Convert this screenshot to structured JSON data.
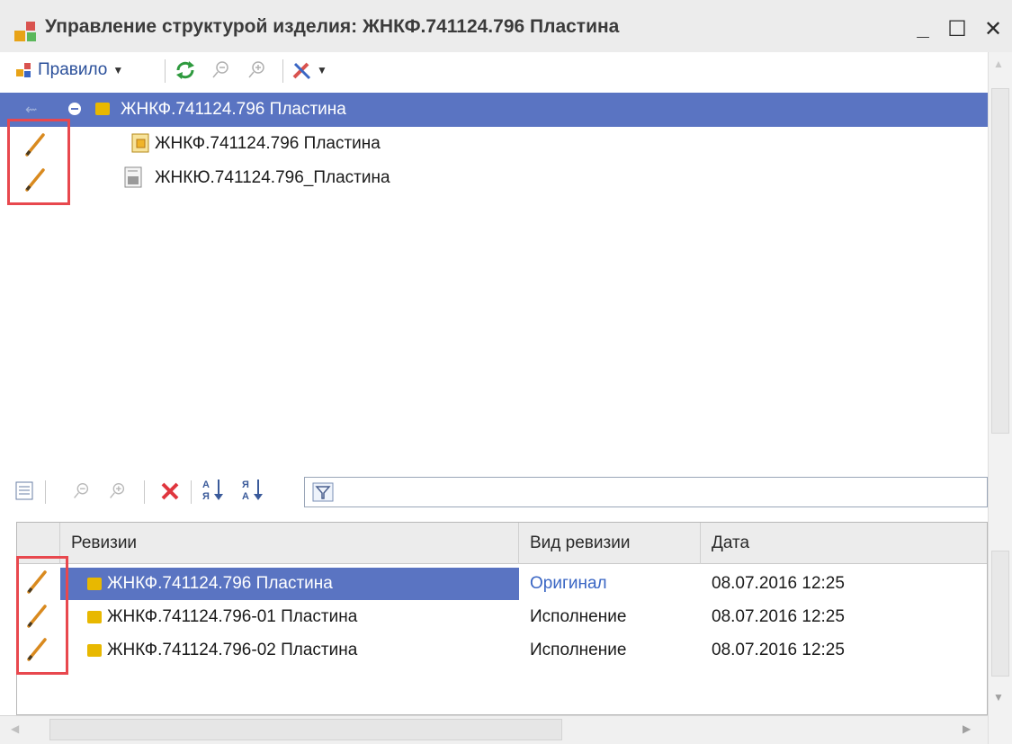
{
  "window": {
    "title": "Управление структурой изделия: ЖНКФ.741124.796 Пластина",
    "minimize": "_",
    "maximize": "☐",
    "close": "✕"
  },
  "toolbar": {
    "rule_menu": "Правило"
  },
  "tree": {
    "items": [
      {
        "label": "ЖНКФ.741124.796 Пластина",
        "selected": true
      },
      {
        "label": "ЖНКФ.741124.796 Пластина",
        "selected": false
      },
      {
        "label": "ЖНКЮ.741124.796_Пластина",
        "selected": false
      }
    ]
  },
  "revisions": {
    "columns": [
      "Ревизии",
      "Вид ревизии",
      "Дата"
    ],
    "rows": [
      {
        "name": "ЖНКФ.741124.796 Пластина",
        "kind": "Оригинал",
        "date": "08.07.2016 12:25",
        "selected": true
      },
      {
        "name": "ЖНКФ.741124.796-01 Пластина",
        "kind": "Исполнение",
        "date": "08.07.2016 12:25",
        "selected": false
      },
      {
        "name": "ЖНКФ.741124.796-02 Пластина",
        "kind": "Исполнение",
        "date": "08.07.2016 12:25",
        "selected": false
      }
    ]
  },
  "colors": {
    "selection": "#5a74c2",
    "original_kind": "#3a66c4",
    "highlight_box": "#e8484e",
    "folder": "#e8b800"
  }
}
